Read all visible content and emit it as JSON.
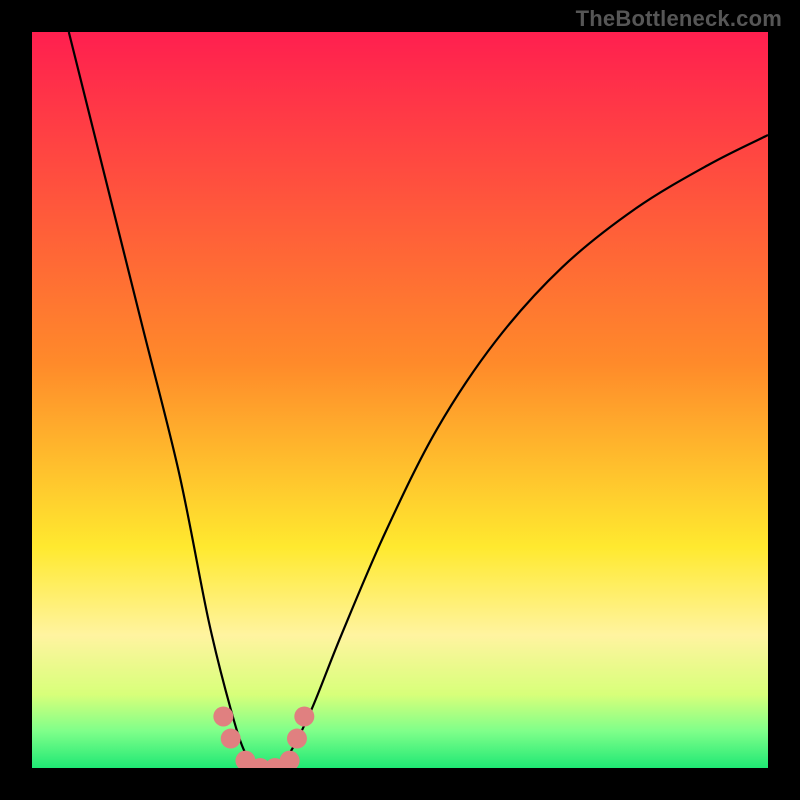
{
  "watermark": "TheBottleneck.com",
  "chart_data": {
    "type": "line",
    "title": "",
    "xlabel": "",
    "ylabel": "",
    "xlim": [
      0,
      100
    ],
    "ylim": [
      0,
      100
    ],
    "series": [
      {
        "name": "bottleneck-curve",
        "x": [
          5,
          10,
          15,
          20,
          24,
          27,
          29,
          31,
          33,
          35,
          38,
          42,
          48,
          55,
          63,
          72,
          82,
          92,
          100
        ],
        "y": [
          100,
          80,
          60,
          40,
          20,
          8,
          2,
          0,
          0,
          2,
          8,
          18,
          32,
          46,
          58,
          68,
          76,
          82,
          86
        ]
      }
    ],
    "markers": {
      "name": "highlight-points",
      "color": "#e08080",
      "x": [
        26,
        27,
        29,
        31,
        33,
        35,
        36,
        37
      ],
      "y": [
        7,
        4,
        1,
        0,
        0,
        1,
        4,
        7
      ]
    },
    "background_gradient": {
      "stops": [
        {
          "pos": 0.0,
          "color": "#ff1f4f"
        },
        {
          "pos": 0.45,
          "color": "#ff8a2a"
        },
        {
          "pos": 0.7,
          "color": "#ffe92f"
        },
        {
          "pos": 0.82,
          "color": "#fff4a0"
        },
        {
          "pos": 0.9,
          "color": "#d8ff7a"
        },
        {
          "pos": 0.95,
          "color": "#7fff8a"
        },
        {
          "pos": 1.0,
          "color": "#1fe874"
        }
      ]
    }
  }
}
